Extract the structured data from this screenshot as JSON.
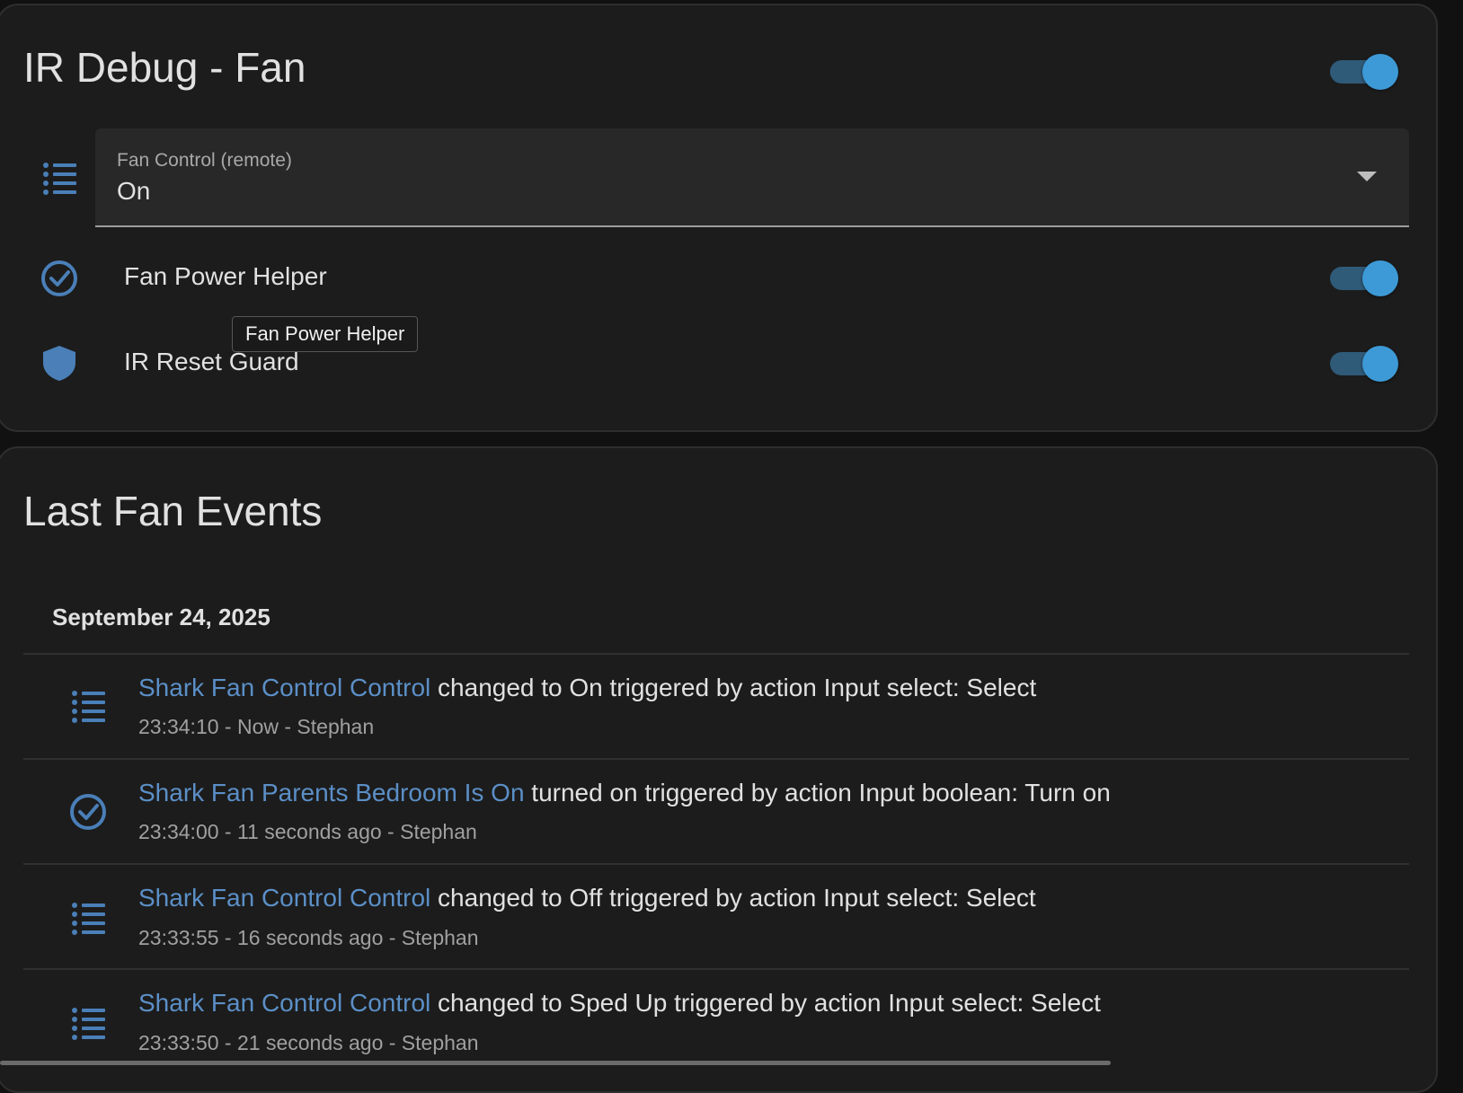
{
  "card1": {
    "title": "IR Debug - Fan",
    "header_toggle": {
      "on": true
    },
    "select": {
      "label": "Fan Control (remote)",
      "value": "On",
      "icon": "format-list-bulleted-icon"
    },
    "rows": [
      {
        "name": "Fan Power Helper",
        "icon": "check-circle-outline-icon",
        "on": true
      },
      {
        "name": "IR Reset Guard",
        "icon": "shield-icon",
        "on": true
      }
    ],
    "tooltip": "Fan Power Helper"
  },
  "card2": {
    "title": "Last Fan Events",
    "date": "September 24, 2025",
    "events": [
      {
        "icon": "format-list-bulleted-icon",
        "entity": "Shark Fan Control Control",
        "text": " changed to On triggered by action Input select: Select",
        "meta": "23:34:10 - Now - Stephan"
      },
      {
        "icon": "check-circle-outline-icon",
        "entity": "Shark Fan Parents Bedroom Is On",
        "text": " turned on triggered by action Input boolean: Turn on",
        "meta": "23:34:00 - 11 seconds ago - Stephan"
      },
      {
        "icon": "format-list-bulleted-icon",
        "entity": "Shark Fan Control Control",
        "text": " changed to Off triggered by action Input select: Select",
        "meta": "23:33:55 - 16 seconds ago - Stephan"
      },
      {
        "icon": "format-list-bulleted-icon",
        "entity": "Shark Fan Control Control",
        "text": " changed to Sped Up triggered by action Input select: Select",
        "meta": "23:33:50 - 21 seconds ago - Stephan"
      }
    ]
  },
  "colors": {
    "background": "#111111",
    "card": "#1c1c1c",
    "accent": "#3d9ad6",
    "icon": "#4a7fb8",
    "link": "#5b8fc7"
  }
}
